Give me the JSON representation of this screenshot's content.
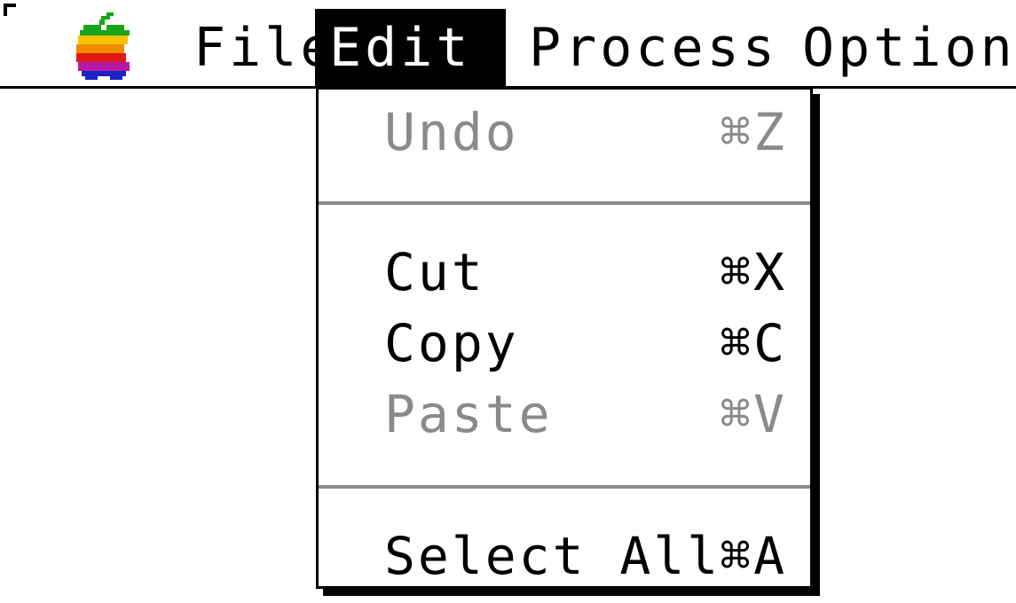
{
  "menubar": {
    "menus": [
      {
        "label": "File"
      },
      {
        "label": "Edit",
        "active": true
      },
      {
        "label": "Process"
      },
      {
        "label": "Option"
      }
    ]
  },
  "edit_menu": {
    "items": [
      {
        "label": "Undo",
        "shortcut": "⌘Z",
        "enabled": false
      },
      {
        "label": "Cut",
        "shortcut": "⌘X",
        "enabled": true
      },
      {
        "label": "Copy",
        "shortcut": "⌘C",
        "enabled": true
      },
      {
        "label": "Paste",
        "shortcut": "⌘V",
        "enabled": false
      },
      {
        "label": "Select All",
        "shortcut": "⌘A",
        "enabled": true
      }
    ]
  },
  "colors": {
    "disabled_text": "#8a8a8a",
    "highlight": "#000000",
    "apple_stripes": [
      "#19a319",
      "#f5c400",
      "#f08a00",
      "#e01818",
      "#b21aa6",
      "#1b22c8"
    ]
  },
  "icons": {
    "apple_menu": "rainbow-apple-icon",
    "corner": "window-corner-icon"
  }
}
